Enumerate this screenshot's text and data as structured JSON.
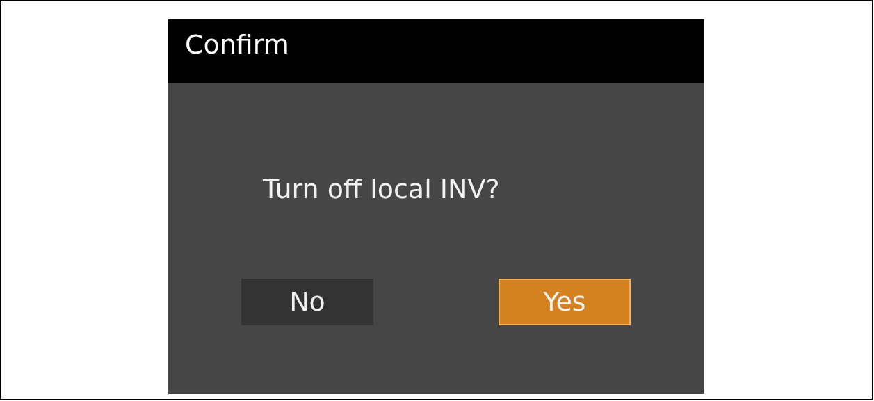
{
  "dialog": {
    "title": "Confirm",
    "message": "Turn off local INV?",
    "buttons": [
      {
        "label": "No",
        "selected": false
      },
      {
        "label": "Yes",
        "selected": true
      }
    ]
  }
}
